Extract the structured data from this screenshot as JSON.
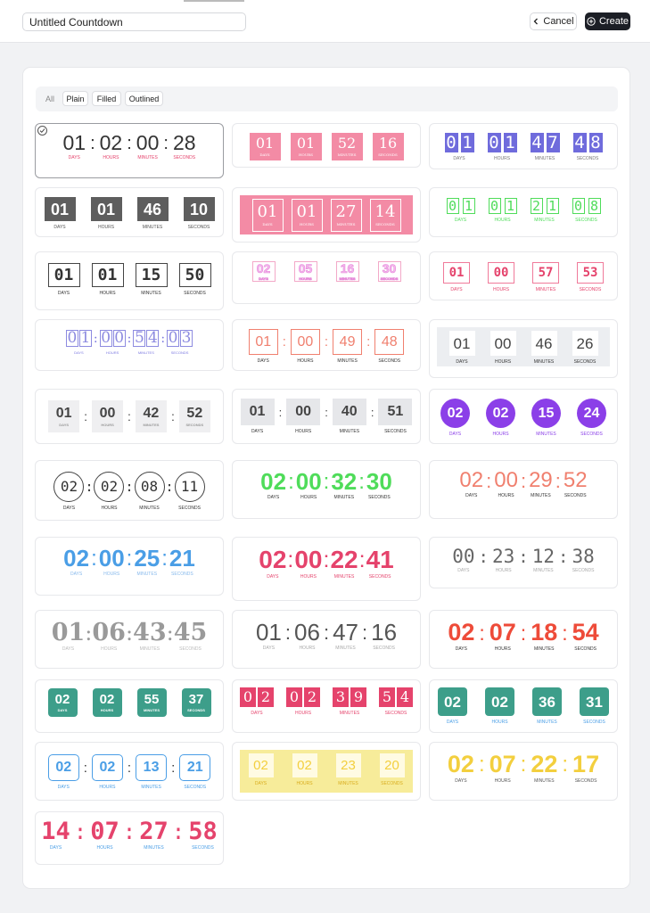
{
  "header": {
    "title_value": "Untitled Countdown",
    "cancel_label": "Cancel",
    "create_label": "Create"
  },
  "tabs": [
    {
      "label": "All"
    },
    {
      "label": "Plain"
    },
    {
      "label": "Filled"
    },
    {
      "label": "Outlined"
    }
  ],
  "templates": [
    {
      "digits": [
        "01",
        "02",
        "00",
        "28"
      ],
      "labels": [
        "DAYS",
        "HOURS",
        "MINUTES",
        "SECONDS"
      ],
      "selected": true
    },
    {
      "digits": [
        "01",
        "01",
        "52",
        "16"
      ],
      "labels": [
        "DAYS",
        "HOURS",
        "MINUTES",
        "SECONDS"
      ]
    },
    {
      "digits": [
        "01",
        "01",
        "47",
        "48"
      ],
      "labels": [
        "DAYS",
        "HOURS",
        "MINUTES",
        "SECONDS"
      ]
    },
    {
      "digits": [
        "01",
        "01",
        "46",
        "10"
      ],
      "labels": [
        "DAYS",
        "HOURS",
        "MINUTES",
        "SECONDS"
      ]
    },
    {
      "digits": [
        "01",
        "01",
        "27",
        "14"
      ],
      "labels": [
        "DAYS",
        "HOURS",
        "MINUTES",
        "SECONDS"
      ]
    },
    {
      "digits": [
        "01",
        "01",
        "21",
        "08"
      ],
      "labels": [
        "DAYS",
        "HOURS",
        "MINUTES",
        "SECONDS"
      ]
    },
    {
      "digits": [
        "01",
        "01",
        "15",
        "50"
      ],
      "labels": [
        "DAYS",
        "HOURS",
        "MINUTES",
        "SECONDS"
      ]
    },
    {
      "digits": [
        "02",
        "05",
        "16",
        "30"
      ],
      "labels": [
        "DAYS",
        "HOURS",
        "MINUTES",
        "SECONDS"
      ]
    },
    {
      "digits": [
        "01",
        "00",
        "57",
        "53"
      ],
      "labels": [
        "DAYS",
        "HOURS",
        "MINUTES",
        "SECONDS"
      ]
    },
    {
      "digits": [
        "01",
        "00",
        "54",
        "03"
      ],
      "labels": [
        "DAYS",
        "HOURS",
        "MINUTES",
        "SECONDS"
      ]
    },
    {
      "digits": [
        "01",
        "00",
        "49",
        "48"
      ],
      "labels": [
        "DAYS",
        "HOURS",
        "MINUTES",
        "SECONDS"
      ]
    },
    {
      "digits": [
        "01",
        "00",
        "46",
        "26"
      ],
      "labels": [
        "DAYS",
        "HOURS",
        "MINUTES",
        "SECONDS"
      ]
    },
    {
      "digits": [
        "01",
        "00",
        "42",
        "52"
      ],
      "labels": [
        "DAYS",
        "HOURS",
        "MINUTES",
        "SECONDS"
      ]
    },
    {
      "digits": [
        "01",
        "00",
        "40",
        "51"
      ],
      "labels": [
        "DAYS",
        "HOURS",
        "MINUTES",
        "SECONDS"
      ]
    },
    {
      "digits": [
        "02",
        "02",
        "15",
        "24"
      ],
      "labels": [
        "DAYS",
        "HOURS",
        "MINUTES",
        "SECONDS"
      ]
    },
    {
      "digits": [
        "02",
        "02",
        "08",
        "11"
      ],
      "labels": [
        "DAYS",
        "HOURS",
        "MINUTES",
        "SECONDS"
      ]
    },
    {
      "digits": [
        "02",
        "00",
        "32",
        "30"
      ],
      "labels": [
        "DAYS",
        "HOURS",
        "MINUTES",
        "SECONDS"
      ]
    },
    {
      "digits": [
        "02",
        "00",
        "29",
        "52"
      ],
      "labels": [
        "DAYS",
        "HOURS",
        "MINUTES",
        "SECONDS"
      ]
    },
    {
      "digits": [
        "02",
        "00",
        "25",
        "21"
      ],
      "labels": [
        "DAYS",
        "HOURS",
        "MINUTES",
        "SECONDS"
      ]
    },
    {
      "digits": [
        "02",
        "00",
        "22",
        "41"
      ],
      "labels": [
        "DAYS",
        "HOURS",
        "MINUTES",
        "SECONDS"
      ]
    },
    {
      "digits": [
        "00",
        "23",
        "12",
        "38"
      ],
      "labels": [
        "DAYS",
        "HOURS",
        "MINUTES",
        "SECONDS"
      ]
    },
    {
      "digits": [
        "01",
        "06",
        "43",
        "45"
      ],
      "labels": [
        "DAYS",
        "HOURS",
        "MINUTES",
        "SECONDS"
      ]
    },
    {
      "digits": [
        "01",
        "06",
        "47",
        "16"
      ],
      "labels": [
        "DAYS",
        "HOURS",
        "MINUTES",
        "SECONDS"
      ]
    },
    {
      "digits": [
        "02",
        "07",
        "18",
        "54"
      ],
      "labels": [
        "DAYS",
        "HOURS",
        "MINUTES",
        "SECONDS"
      ]
    },
    {
      "digits": [
        "02",
        "02",
        "55",
        "37"
      ],
      "labels": [
        "DAYS",
        "HOURS",
        "MINUTES",
        "SECONDS"
      ]
    },
    {
      "digits": [
        "02",
        "02",
        "39",
        "54"
      ],
      "labels": [
        "DAYS",
        "HOURS",
        "MINUTES",
        "SECONDS"
      ]
    },
    {
      "digits": [
        "02",
        "02",
        "36",
        "31"
      ],
      "labels": [
        "DAYS",
        "HOURS",
        "MINUTES",
        "SECONDS"
      ]
    },
    {
      "digits": [
        "02",
        "02",
        "13",
        "21"
      ],
      "labels": [
        "DAYS",
        "HOURS",
        "MINUTES",
        "SECONDS"
      ]
    },
    {
      "digits": [
        "02",
        "02",
        "23",
        "20"
      ],
      "labels": [
        "DAYS",
        "HOURS",
        "MINUTES",
        "SECONDS"
      ]
    },
    {
      "digits": [
        "02",
        "07",
        "22",
        "17"
      ],
      "labels": [
        "DAYS",
        "HOURS",
        "MINUTES",
        "SECONDS"
      ]
    },
    {
      "digits": [
        "14",
        "07",
        "27",
        "58"
      ],
      "labels": [
        "DAYS",
        "HOURS",
        "MINUTES",
        "SECONDS"
      ]
    }
  ],
  "colors": {
    "primary_button": "#1c1f26",
    "pink": "#f38ba5",
    "violet": "#6f6bdc",
    "green": "#4fdc5a",
    "salmon": "#f0806f",
    "purple": "#8b3fe8",
    "blue": "#4a9ee6",
    "crimson": "#e5436c",
    "red": "#ee4b39",
    "teal": "#3d9e8a",
    "yellow": "#f7ec9a",
    "gold": "#f3cf3e"
  }
}
